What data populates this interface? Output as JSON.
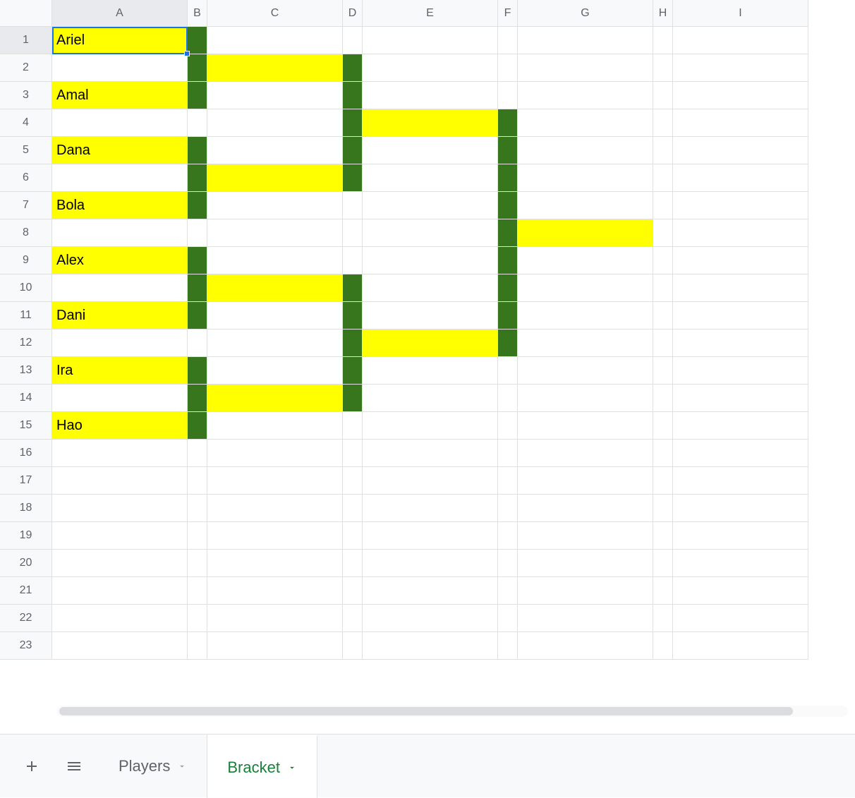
{
  "columns": [
    "A",
    "B",
    "C",
    "D",
    "E",
    "F",
    "G",
    "H",
    "I"
  ],
  "colWidths": {
    "A": "w-A",
    "B": "w-B",
    "C": "w-C",
    "D": "w-D",
    "E": "w-E",
    "F": "w-F",
    "G": "w-G",
    "H": "w-H",
    "I": "w-I"
  },
  "rows": 23,
  "selectedCell": {
    "row": 1,
    "col": "A"
  },
  "cells": {
    "A1": {
      "value": "Ariel",
      "fill": "yellow"
    },
    "B1": {
      "fill": "green"
    },
    "B2": {
      "fill": "green"
    },
    "C2": {
      "fill": "yellow"
    },
    "D2": {
      "fill": "green"
    },
    "A3": {
      "value": "Amal",
      "fill": "yellow"
    },
    "B3": {
      "fill": "green"
    },
    "D3": {
      "fill": "green"
    },
    "D4": {
      "fill": "green"
    },
    "E4": {
      "fill": "yellow"
    },
    "F4": {
      "fill": "green"
    },
    "A5": {
      "value": "Dana",
      "fill": "yellow"
    },
    "B5": {
      "fill": "green"
    },
    "D5": {
      "fill": "green"
    },
    "F5": {
      "fill": "green"
    },
    "B6": {
      "fill": "green"
    },
    "C6": {
      "fill": "yellow"
    },
    "D6": {
      "fill": "green"
    },
    "F6": {
      "fill": "green"
    },
    "A7": {
      "value": "Bola",
      "fill": "yellow"
    },
    "B7": {
      "fill": "green"
    },
    "F7": {
      "fill": "green"
    },
    "F8": {
      "fill": "green"
    },
    "G8": {
      "fill": "yellow"
    },
    "A9": {
      "value": "Alex",
      "fill": "yellow"
    },
    "B9": {
      "fill": "green"
    },
    "F9": {
      "fill": "green"
    },
    "B10": {
      "fill": "green"
    },
    "C10": {
      "fill": "yellow"
    },
    "D10": {
      "fill": "green"
    },
    "F10": {
      "fill": "green"
    },
    "A11": {
      "value": "Dani",
      "fill": "yellow"
    },
    "B11": {
      "fill": "green"
    },
    "D11": {
      "fill": "green"
    },
    "F11": {
      "fill": "green"
    },
    "D12": {
      "fill": "green"
    },
    "E12": {
      "fill": "yellow"
    },
    "F12": {
      "fill": "green"
    },
    "A13": {
      "value": "Ira",
      "fill": "yellow"
    },
    "B13": {
      "fill": "green"
    },
    "D13": {
      "fill": "green"
    },
    "B14": {
      "fill": "green"
    },
    "C14": {
      "fill": "yellow"
    },
    "D14": {
      "fill": "green"
    },
    "A15": {
      "value": "Hao",
      "fill": "yellow"
    },
    "B15": {
      "fill": "green"
    }
  },
  "tabs": {
    "addLabel": "+",
    "allSheetsLabel": "≡",
    "items": [
      {
        "label": "Players",
        "active": false
      },
      {
        "label": "Bracket",
        "active": true
      }
    ]
  }
}
